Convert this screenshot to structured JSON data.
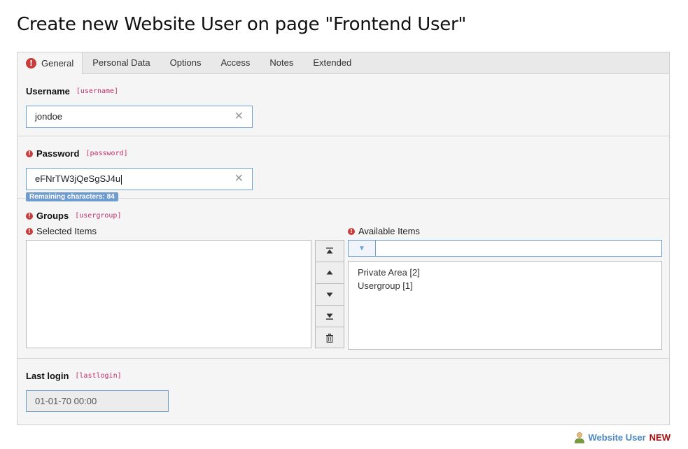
{
  "page": {
    "title": "Create new Website User on page \"Frontend User\""
  },
  "tabs": [
    {
      "label": "General",
      "active": true,
      "has_error": true
    },
    {
      "label": "Personal Data"
    },
    {
      "label": "Options"
    },
    {
      "label": "Access"
    },
    {
      "label": "Notes"
    },
    {
      "label": "Extended"
    }
  ],
  "fields": {
    "username": {
      "label": "Username",
      "key": "[username]",
      "value": "jondoe"
    },
    "password": {
      "label": "Password",
      "key": "[password]",
      "value": "eFNrTW3jQeSgSJ4u",
      "remaining": "Remaining characters: 84"
    },
    "groups": {
      "label": "Groups",
      "key": "[usergroup]",
      "selected_label": "Selected Items",
      "available_label": "Available Items",
      "available_items": [
        "Private Area [2]",
        "Usergroup [1]"
      ]
    },
    "lastlogin": {
      "label": "Last login",
      "key": "[lastlogin]",
      "value": "01-01-70 00:00"
    }
  },
  "footer": {
    "record_type": "Website User",
    "status": "NEW"
  },
  "icons": {
    "clear": "close-icon",
    "error": "exclamation-circle-icon",
    "filter": "filter-icon",
    "move_top": "move-to-top-icon",
    "move_up": "move-up-icon",
    "move_down": "move-down-icon",
    "move_bottom": "move-to-bottom-icon",
    "remove": "trash-icon",
    "user": "user-icon"
  },
  "colors": {
    "error": "#c83c3c",
    "field_key": "#c1306a",
    "input_border": "#6c9fd3",
    "link": "#4a87c1",
    "new_badge": "#a4100f"
  }
}
